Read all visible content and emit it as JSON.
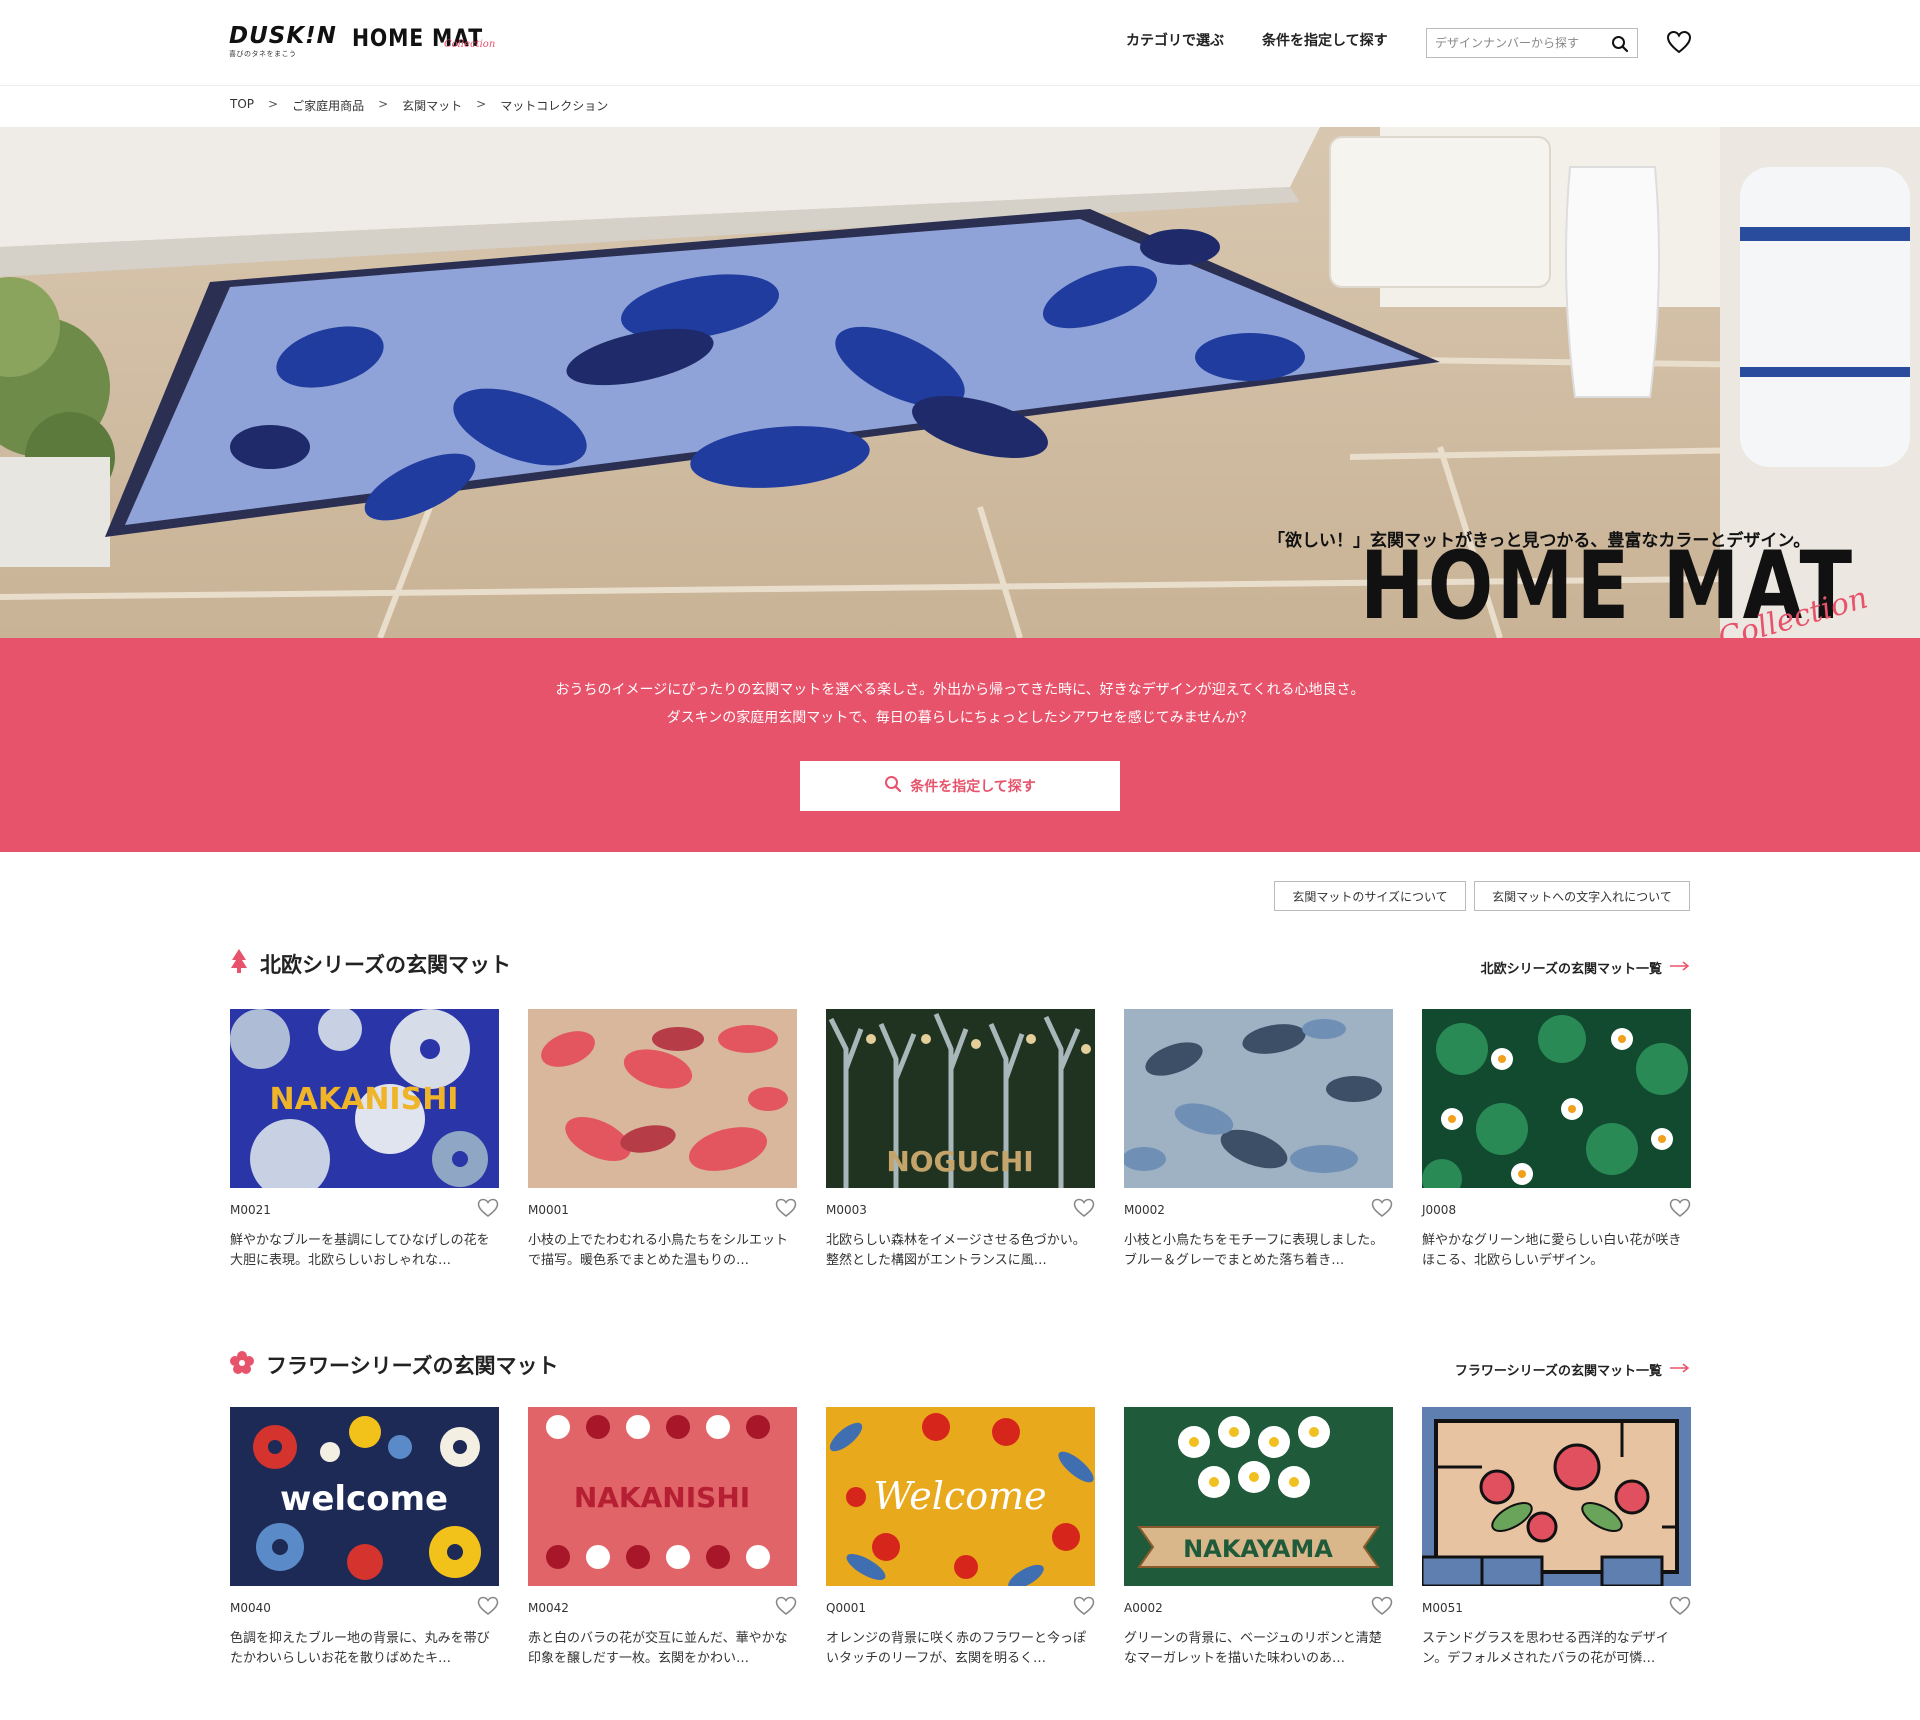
{
  "header": {
    "logo_duskin": "DUSK!N",
    "logo_duskin_tag": "喜びのタネをまこう",
    "logo_homemat": "HOME MAT",
    "logo_homemat_script": "Collection",
    "nav_category": "カテゴリで選ぶ",
    "nav_condition": "条件を指定して探す",
    "search_placeholder": "デザインナンバーから探す"
  },
  "breadcrumb": [
    "TOP",
    "ご家庭用商品",
    "玄関マット",
    "マットコレクション"
  ],
  "breadcrumb_sep": ">",
  "hero": {
    "title": "HOME MAT",
    "script": "Collection",
    "subtitle": "「欲しい！」玄関マットがきっと見つかる、豊富なカラーとデザイン。"
  },
  "band": {
    "line1": "おうちのイメージにぴったりの玄関マットを選べる楽しさ。外出から帰ってきた時に、好きなデザインが迎えてくれる心地良さ。",
    "line2": "ダスキンの家庭用玄関マットで、毎日の暮らしにちょっとしたシアワセを感じてみませんか？",
    "button": "条件を指定して探す"
  },
  "info_buttons": {
    "size": "玄関マットのサイズについて",
    "lettering": "玄関マットへの文字入れについて"
  },
  "sections": [
    {
      "title": "北欧シリーズの玄関マット",
      "link": "北欧シリーズの玄関マット一覧",
      "items": [
        {
          "code": "M0021",
          "desc": "鮮やかなブルーを基調にしてひなげしの花を大胆に表現。北欧らしいおしゃれな…",
          "label": "NAKANISHI"
        },
        {
          "code": "M0001",
          "desc": "小枝の上でたわむれる小鳥たちをシルエットで描写。暖色系でまとめた温もりの…",
          "label": ""
        },
        {
          "code": "M0003",
          "desc": "北欧らしい森林をイメージさせる色づかい。整然とした構図がエントランスに風…",
          "label": "NOGUCHI"
        },
        {
          "code": "M0002",
          "desc": "小枝と小鳥たちをモチーフに表現しました。ブルー＆グレーでまとめた落ち着き…",
          "label": ""
        },
        {
          "code": "J0008",
          "desc": "鮮やかなグリーン地に愛らしい白い花が咲きほこる、北欧らしいデザイン。",
          "label": ""
        }
      ]
    },
    {
      "title": "フラワーシリーズの玄関マット",
      "link": "フラワーシリーズの玄関マット一覧",
      "items": [
        {
          "code": "M0040",
          "desc": "色調を抑えたブルー地の背景に、丸みを帯びたかわいらしいお花を散りばめたキ…",
          "label": "welcome"
        },
        {
          "code": "M0042",
          "desc": "赤と白のバラの花が交互に並んだ、華やかな印象を醸しだす一枚。玄関をかわい…",
          "label": "NAKANISHI"
        },
        {
          "code": "Q0001",
          "desc": "オレンジの背景に咲く赤のフラワーと今っぽいタッチのリーフが、玄関を明るく…",
          "label": "Welcome"
        },
        {
          "code": "A0002",
          "desc": "グリーンの背景に、ベージュのリボンと清楚なマーガレットを描いた味わいのあ…",
          "label": "NAKAYAMA"
        },
        {
          "code": "M0051",
          "desc": "ステンドグラスを思わせる西洋的なデザイン。デフォルメされたバラの花が可憐…",
          "label": ""
        }
      ]
    }
  ],
  "colors": {
    "accent": "#e8536c"
  }
}
